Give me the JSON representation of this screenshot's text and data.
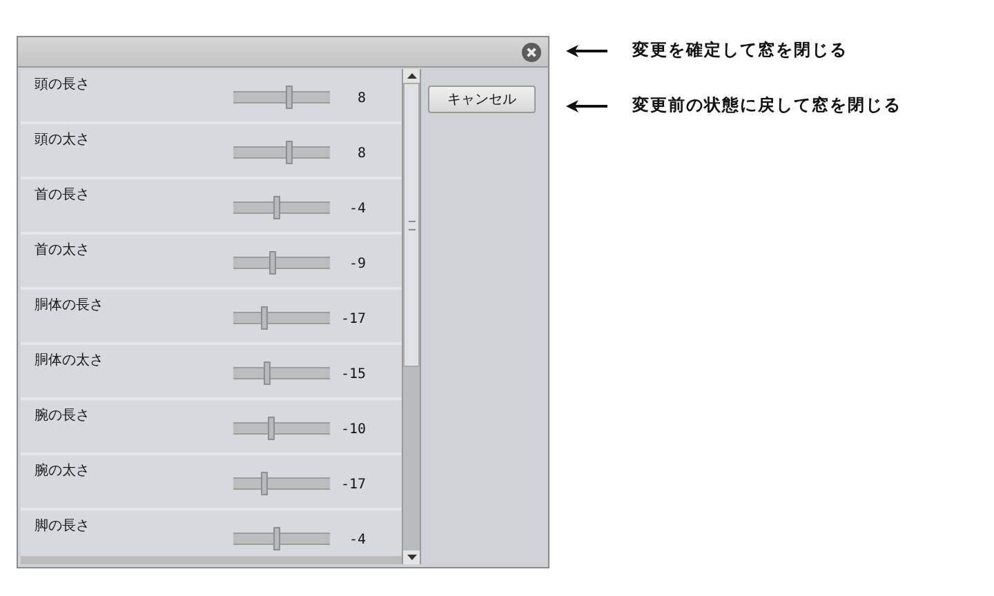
{
  "sliders": [
    {
      "label": "頭の長さ",
      "level": 0.58,
      "reading": "8"
    },
    {
      "label": "頭の太さ",
      "level": 0.58,
      "reading": "8"
    },
    {
      "label": "首の長さ",
      "level": 0.46,
      "reading": "-4"
    },
    {
      "label": "首の太さ",
      "level": 0.41,
      "reading": "-9"
    },
    {
      "label": "胴体の長さ",
      "level": 0.33,
      "reading": "-17"
    },
    {
      "label": "胴体の太さ",
      "level": 0.35,
      "reading": "-15"
    },
    {
      "label": "腕の長さ",
      "level": 0.4,
      "reading": "-10"
    },
    {
      "label": "腕の太さ",
      "level": 0.33,
      "reading": "-17"
    },
    {
      "label": "脚の長さ",
      "level": 0.46,
      "reading": "-4"
    }
  ],
  "buttons": [
    "キャンセル"
  ],
  "annotations": [
    "変更を確定して窓を閉じる",
    "変更前の状態に戻して窓を閉じる"
  ]
}
